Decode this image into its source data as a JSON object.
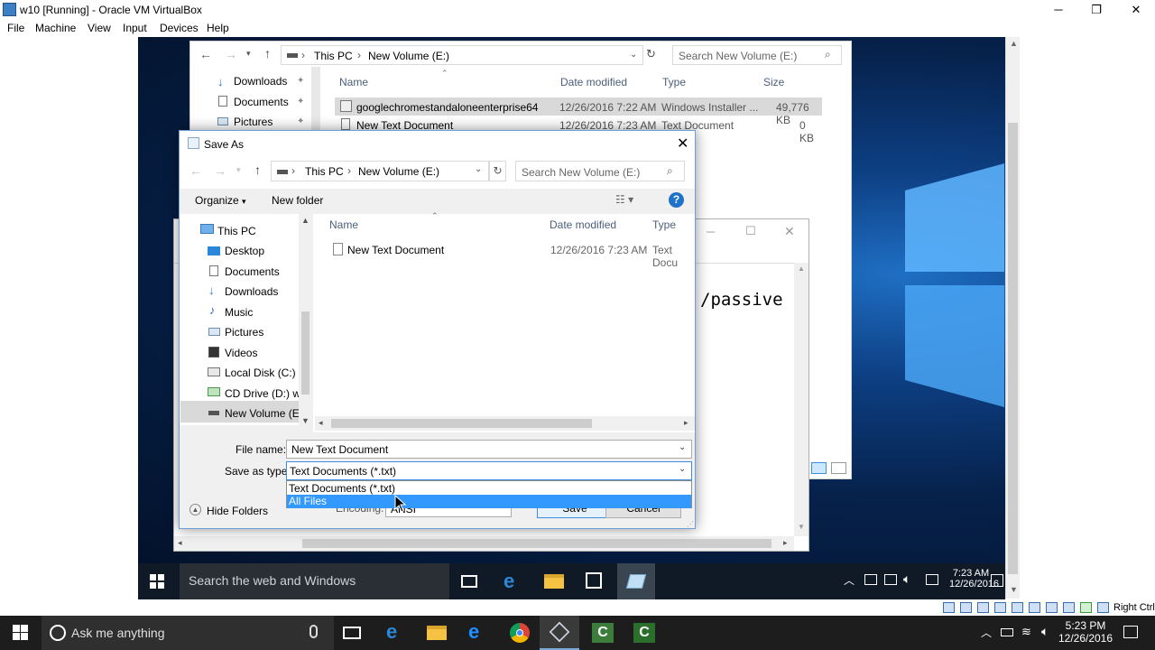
{
  "host": {
    "title": "w10 [Running] - Oracle VM VirtualBox",
    "menu": [
      "File",
      "Machine",
      "View",
      "Input",
      "Devices",
      "Help"
    ],
    "right_ctrl": "Right Ctrl",
    "taskbar": {
      "search_placeholder": "Ask me anything",
      "time": "5:23 PM",
      "date": "12/26/2016"
    }
  },
  "guest_taskbar": {
    "search_placeholder": "Search the web and Windows",
    "time": "7:23 AM",
    "date": "12/26/2016"
  },
  "explorer": {
    "breadcrumb": [
      "This PC",
      "New Volume (E:)"
    ],
    "search_placeholder": "Search New Volume (E:)",
    "quick_access": [
      "Downloads",
      "Documents",
      "Pictures"
    ],
    "columns": [
      "Name",
      "Date modified",
      "Type",
      "Size"
    ],
    "rows": [
      {
        "name": "googlechromestandaloneenterprise64",
        "date": "12/26/2016 7:22 AM",
        "type": "Windows Installer ...",
        "size": "49,776 KB"
      },
      {
        "name": "New Text Document",
        "date": "12/26/2016 7:23 AM",
        "type": "Text Document",
        "size": "0 KB"
      }
    ]
  },
  "notepad": {
    "text": "/passive"
  },
  "dialog": {
    "title": "Save As",
    "breadcrumb": [
      "This PC",
      "New Volume (E:)"
    ],
    "search_placeholder": "Search New Volume (E:)",
    "toolbar": {
      "organize": "Organize",
      "new_folder": "New folder"
    },
    "nav": [
      "This PC",
      "Desktop",
      "Documents",
      "Downloads",
      "Music",
      "Pictures",
      "Videos",
      "Local Disk (C:)",
      "CD Drive (D:) wir",
      "New Volume (E:)"
    ],
    "columns": [
      "Name",
      "Date modified",
      "Type"
    ],
    "files": [
      {
        "name": "New Text Document",
        "date": "12/26/2016 7:23 AM",
        "type": "Text Docu"
      }
    ],
    "file_name_label": "File name:",
    "file_name_value": "New Text Document",
    "save_as_type_label": "Save as type:",
    "save_as_type_value": "Text Documents (*.txt)",
    "type_options": [
      "Text Documents (*.txt)",
      "All Files"
    ],
    "encoding_label": "Encoding:",
    "encoding_value": "ANSI",
    "save_label": "Save",
    "cancel_label": "Cancel",
    "hide_folders": "Hide Folders"
  },
  "colors": {
    "accent": "#0078d7",
    "selection": "#cce8ff",
    "dropdown_highlight": "#3399ff"
  }
}
